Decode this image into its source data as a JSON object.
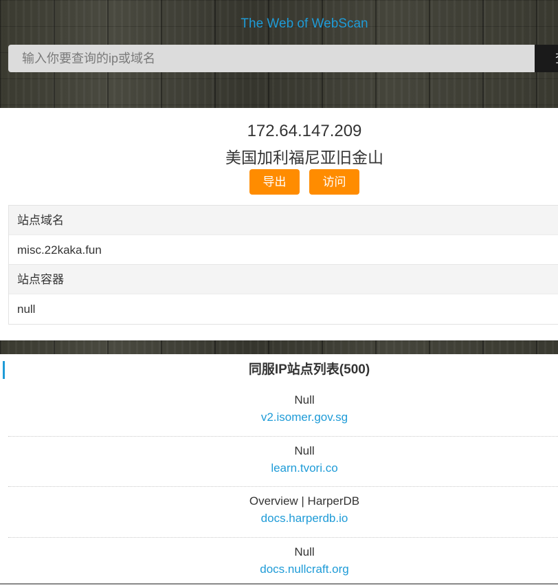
{
  "header": {
    "title": "The Web of WebScan",
    "search_placeholder": "输入你要查询的ip或域名",
    "search_button_label": "查询"
  },
  "result": {
    "ip": "172.64.147.209",
    "location": "美国加利福尼亚旧金山",
    "export_label": "导出",
    "visit_label": "访问",
    "details": [
      {
        "label": "站点域名",
        "value": "misc.22kaka.fun"
      },
      {
        "label": "站点容器",
        "value": "null"
      }
    ]
  },
  "same_ip": {
    "heading": "同服IP站点列表(500)",
    "sites": [
      {
        "name": "Null",
        "domain": "v2.isomer.gov.sg"
      },
      {
        "name": "Null",
        "domain": "learn.tvori.co"
      },
      {
        "name": "Overview | HarperDB",
        "domain": "docs.harperdb.io"
      },
      {
        "name": "Null",
        "domain": "docs.nullcraft.org"
      }
    ]
  },
  "colors": {
    "accent_blue": "#1e9bd7",
    "button_orange": "#ff8c00"
  }
}
